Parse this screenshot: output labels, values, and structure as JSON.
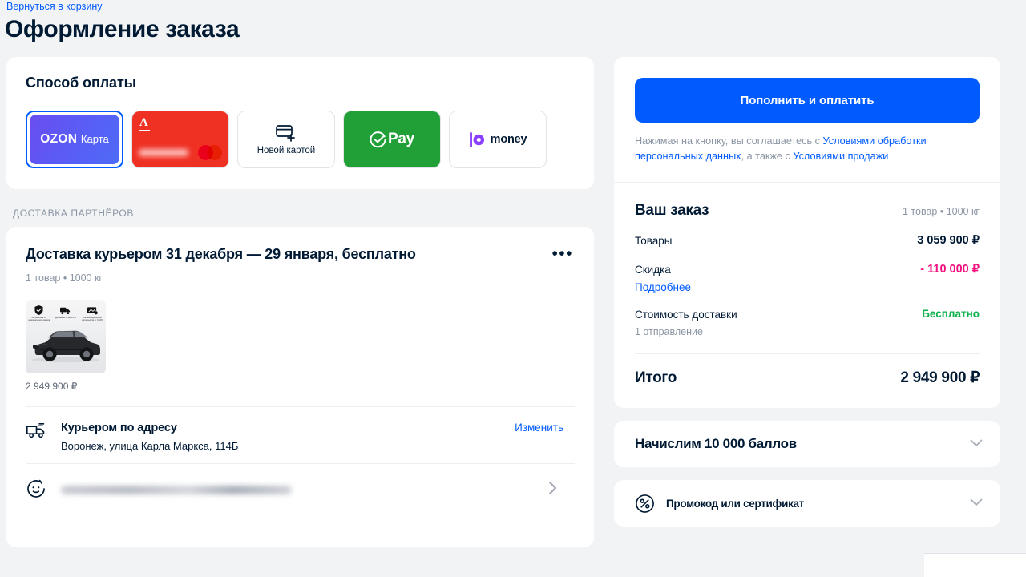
{
  "header": {
    "back_link": "Вернуться в корзину",
    "title": "Оформление заказа"
  },
  "payment": {
    "title": "Способ оплаты",
    "methods": [
      {
        "id": "ozon-card",
        "label": "OZON",
        "sub_label": "Карта",
        "selected": true
      },
      {
        "id": "alfa-card",
        "label": "A",
        "selected": false
      },
      {
        "id": "new-card",
        "label": "Новой картой",
        "selected": false
      },
      {
        "id": "sber-pay",
        "label": "Pay",
        "selected": false
      },
      {
        "id": "yoo-money",
        "label": "money",
        "selected": false
      }
    ]
  },
  "delivery": {
    "section_label": "ДОСТАВКА ПАРТНЁРОВ",
    "title": "Доставка курьером 31 декабря — 29 января, бесплатно",
    "subtitle": "1 товар • 1000 кг",
    "more_menu": "•••",
    "product": {
      "price": "2 949 900 ₽",
      "badges": [
        "Автомобили от официального дилера",
        "Доставим по всей РФ",
        "Онлайн-одобрение автокредита от 0,01%"
      ]
    },
    "address": {
      "title": "Курьером по адресу",
      "value": "Воронеж, улица Карла Маркса, 114Б",
      "change_label": "Изменить"
    },
    "recipient": {
      "value": ""
    }
  },
  "summary": {
    "pay_button": "Пополнить и оплатить",
    "agreement_prefix": "Нажимая на кнопку, вы соглашаетесь с ",
    "agreement_link1": "Условиями обработки персональных данных",
    "agreement_middle": ", а также с ",
    "agreement_link2": "Условиями продажи",
    "order_title": "Ваш заказ",
    "order_meta": "1 товар • 1000 кг",
    "rows": [
      {
        "key": "Товары",
        "value": "3 059 900 ₽",
        "kind": "normal"
      },
      {
        "key": "Скидка",
        "value": "- 110 000 ₽",
        "kind": "discount",
        "sub_link": "Подробнее"
      },
      {
        "key": "Стоимость доставки",
        "value": "Бесплатно",
        "kind": "free",
        "sub_muted": "1 отправление"
      }
    ],
    "total_key": "Итого",
    "total_value": "2 949 900 ₽"
  },
  "accordions": [
    {
      "id": "bonus",
      "title": "Начислим 10 000 баллов",
      "has_icon": false
    },
    {
      "id": "promo",
      "title": "Промокод или сертификат",
      "has_icon": true
    }
  ],
  "colors": {
    "accent": "#005bff",
    "discount": "#f1117e",
    "free": "#0bb14c",
    "ozon_card": "#5b5bf5",
    "alfa": "#ef3124",
    "sber": "#21a038",
    "yoo": "#8b3ffd",
    "page_bg": "#f2f3f5"
  }
}
